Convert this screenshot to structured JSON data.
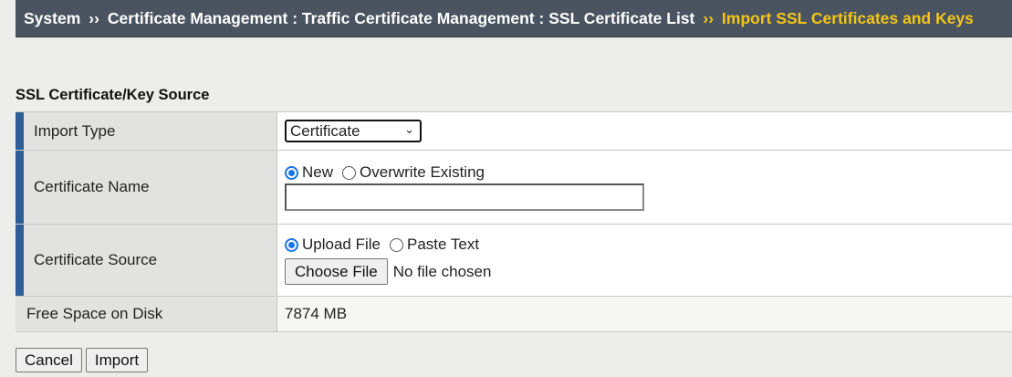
{
  "breadcrumb": {
    "items": [
      "System",
      "Certificate Management : Traffic Certificate Management : SSL Certificate List"
    ],
    "separator": "››",
    "current": "Import SSL Certificates and Keys"
  },
  "section": {
    "title": "SSL Certificate/Key Source"
  },
  "form": {
    "import_type": {
      "label": "Import Type",
      "selected": "Certificate"
    },
    "certificate_name": {
      "label": "Certificate Name",
      "options": [
        "New",
        "Overwrite Existing"
      ],
      "selected": "New",
      "value": ""
    },
    "certificate_source": {
      "label": "Certificate Source",
      "options": [
        "Upload File",
        "Paste Text"
      ],
      "selected": "Upload File",
      "choose_button": "Choose File",
      "file_status": "No file chosen"
    },
    "free_space": {
      "label": "Free Space on Disk",
      "value": "7874 MB"
    }
  },
  "actions": {
    "cancel": "Cancel",
    "import": "Import"
  },
  "colors": {
    "accent": "#2f5e97",
    "current_crumb": "#f5c518",
    "topbar": "#4a5460"
  }
}
